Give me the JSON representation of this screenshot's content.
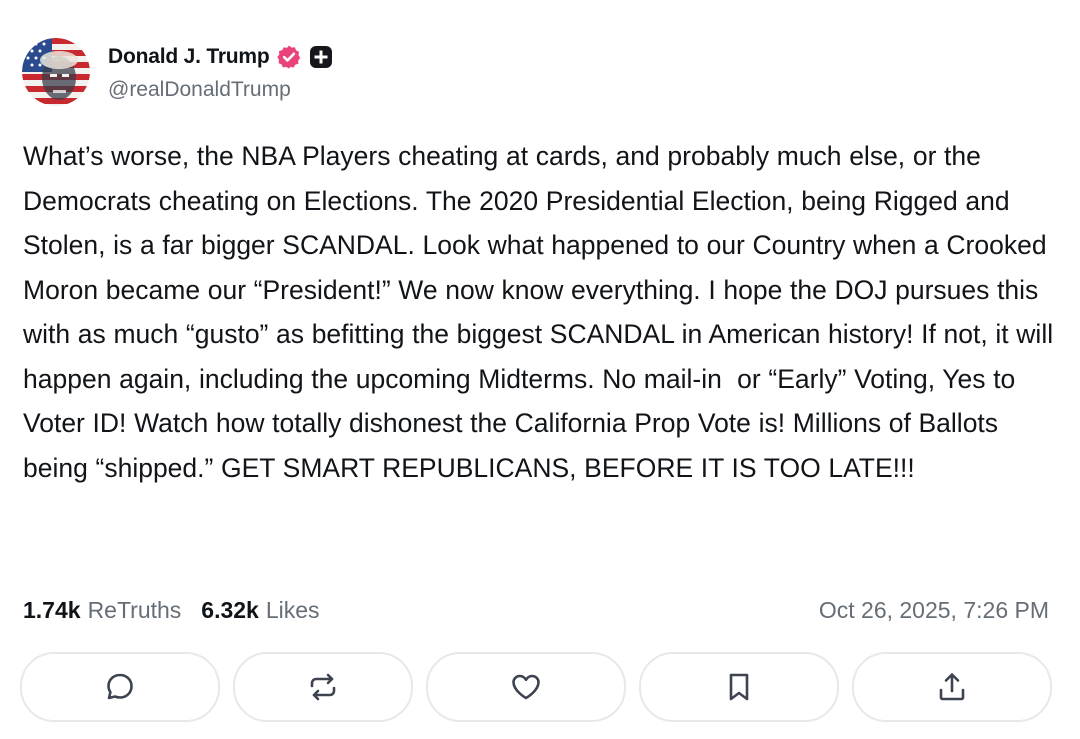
{
  "author": {
    "display_name": "Donald J. Trump",
    "handle": "@realDonaldTrump",
    "avatar_icon": "flag-portrait-avatar",
    "verified_icon": "verified-badge-icon",
    "plus_icon": "plus-badge-icon"
  },
  "post": {
    "text": "What’s worse, the NBA Players cheating at cards, and probably much else, or the Democrats cheating on Elections. The 2020 Presidential Election, being Rigged and Stolen, is a far bigger SCANDAL. Look what happened to our Country when a Crooked Moron became our “President!” We now know everything. I hope the DOJ pursues this with as much “gusto” as befitting the biggest SCANDAL in American history! If not, it will happen again, including the upcoming Midterms. No mail-in  or “Early” Voting, Yes to Voter ID! Watch how totally dishonest the California Prop Vote is! Millions of Ballots being “shipped.” GET SMART REPUBLICANS, BEFORE IT IS TOO LATE!!!"
  },
  "stats": {
    "retruths_count": "1.74k",
    "retruths_label": "ReTruths",
    "likes_count": "6.32k",
    "likes_label": "Likes"
  },
  "timestamp": "Oct 26, 2025, 7:26 PM",
  "actions": [
    {
      "name": "reply",
      "icon": "comment-icon"
    },
    {
      "name": "retruth",
      "icon": "repost-icon"
    },
    {
      "name": "like",
      "icon": "heart-icon"
    },
    {
      "name": "bookmark",
      "icon": "bookmark-icon"
    },
    {
      "name": "share",
      "icon": "share-icon"
    }
  ],
  "colors": {
    "verified_pink": "#e8447b",
    "text_primary": "#0f1419",
    "text_secondary": "#656d76",
    "button_border": "#e6e8eb"
  }
}
